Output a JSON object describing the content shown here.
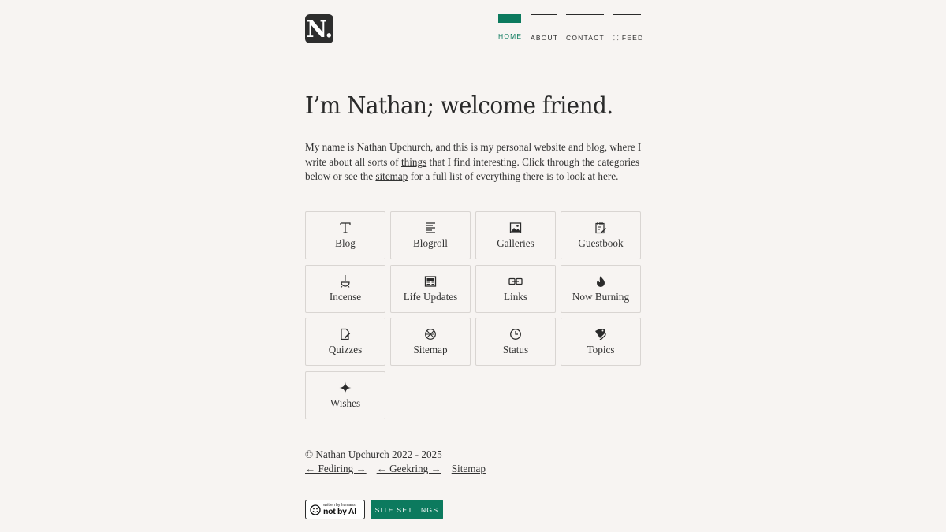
{
  "header": {
    "logo_text": "N.",
    "nav": [
      {
        "label": "HOME",
        "active": true
      },
      {
        "label": "ABOUT",
        "active": false
      },
      {
        "label": "CONTACT",
        "active": false
      },
      {
        "label": "FEED",
        "active": false,
        "icon": "rss-icon"
      }
    ]
  },
  "hero": {
    "title": "I’m Nathan; welcome friend.",
    "intro_pre": "My name is Nathan Upchurch, and this is my personal website and blog, where I write about all sorts of ",
    "intro_link1": "things",
    "intro_mid": " that I find interesting. Click through the categories below or see the ",
    "intro_link2": "sitemap",
    "intro_post": " for a full list of everything there is to look at here."
  },
  "categories": [
    {
      "label": "Blog",
      "icon": "text-t-icon"
    },
    {
      "label": "Blogroll",
      "icon": "list-lines-icon"
    },
    {
      "label": "Galleries",
      "icon": "image-icon"
    },
    {
      "label": "Guestbook",
      "icon": "notepad-pencil-icon"
    },
    {
      "label": "Incense",
      "icon": "incense-burner-icon"
    },
    {
      "label": "Life Updates",
      "icon": "newspaper-icon"
    },
    {
      "label": "Links",
      "icon": "chain-link-icon"
    },
    {
      "label": "Now Burning",
      "icon": "flame-icon"
    },
    {
      "label": "Quizzes",
      "icon": "document-pencil-icon"
    },
    {
      "label": "Sitemap",
      "icon": "globe-x-icon"
    },
    {
      "label": "Status",
      "icon": "clock-icon"
    },
    {
      "label": "Topics",
      "icon": "tags-icon"
    },
    {
      "label": "Wishes",
      "icon": "sparkle-icon"
    }
  ],
  "footer": {
    "copyright": "© Nathan Upchurch 2022 - 2025",
    "links": [
      "← Fediring →",
      "← Geekring →",
      "Sitemap"
    ]
  },
  "badges": {
    "human_small": "written by humans",
    "human_big": "not by AI",
    "settings_label": "SITE SETTINGS"
  },
  "colors": {
    "accent": "#0c7a5e",
    "background": "#f7f4f2",
    "text": "#2b2b2b"
  }
}
